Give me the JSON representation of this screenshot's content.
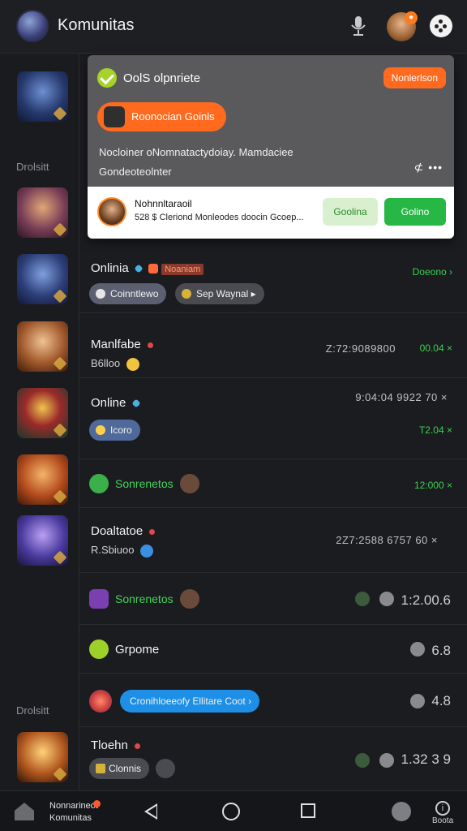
{
  "header": {
    "title": "Komunitas"
  },
  "sidebar": {
    "labels": [
      "Drolsitt",
      "Drolsitt"
    ]
  },
  "popup": {
    "title": "OolS olpnriete",
    "badge": "Nonlerlson",
    "chip": "Roonocian Goinls",
    "line1": "Nocloiner oNomnatactydoiay. Mamdaciee",
    "line2": "Gondeoteolnter",
    "dots": "⊄ •••",
    "card": {
      "name": "Nohnnltaraoil",
      "desc": "528 $ Cleriond Monleodes doocin Gcoep...",
      "btn1": "Goolina",
      "btn2": "Golino"
    }
  },
  "rows": [
    {
      "name": "Onlinia",
      "tag": "Noaniam",
      "green": "Doeono ›",
      "pill1": "Coinntlewo",
      "pill2": "Sep Waynal ▸"
    },
    {
      "name": "Manlfabe",
      "sub": "B6lloo",
      "time": "Z:72:9089800",
      "green": "00.04 ×"
    },
    {
      "name": "Online",
      "time": "9:04:04 9922 70 ×",
      "green": "T2.04 ×",
      "pill": "Icoro"
    },
    {
      "name": "Sonrenetos",
      "green": "12:000 ×"
    },
    {
      "name": "Doaltatoe",
      "sub": "R.Sbiuoo",
      "time": "2Z7:2588 6757 60 ×"
    },
    {
      "name": "Sonrenetos",
      "nums": "1:2.00.6"
    },
    {
      "name": "Grpome",
      "nums": "6.8"
    },
    {
      "pill": "Cronihloeeofy Ellitare Coot ›",
      "nums": "4.8"
    },
    {
      "name": "Tloehn",
      "pill1": "Clonnis",
      "nums": "1.32 3 9"
    }
  ],
  "bottom": {
    "label1": "Nonnarineot",
    "label2": "Komunitas",
    "info_label": "Boota"
  },
  "colors": {
    "accent_orange": "#ff6a1f",
    "accent_green": "#27b745",
    "bg": "#1b1c20"
  }
}
